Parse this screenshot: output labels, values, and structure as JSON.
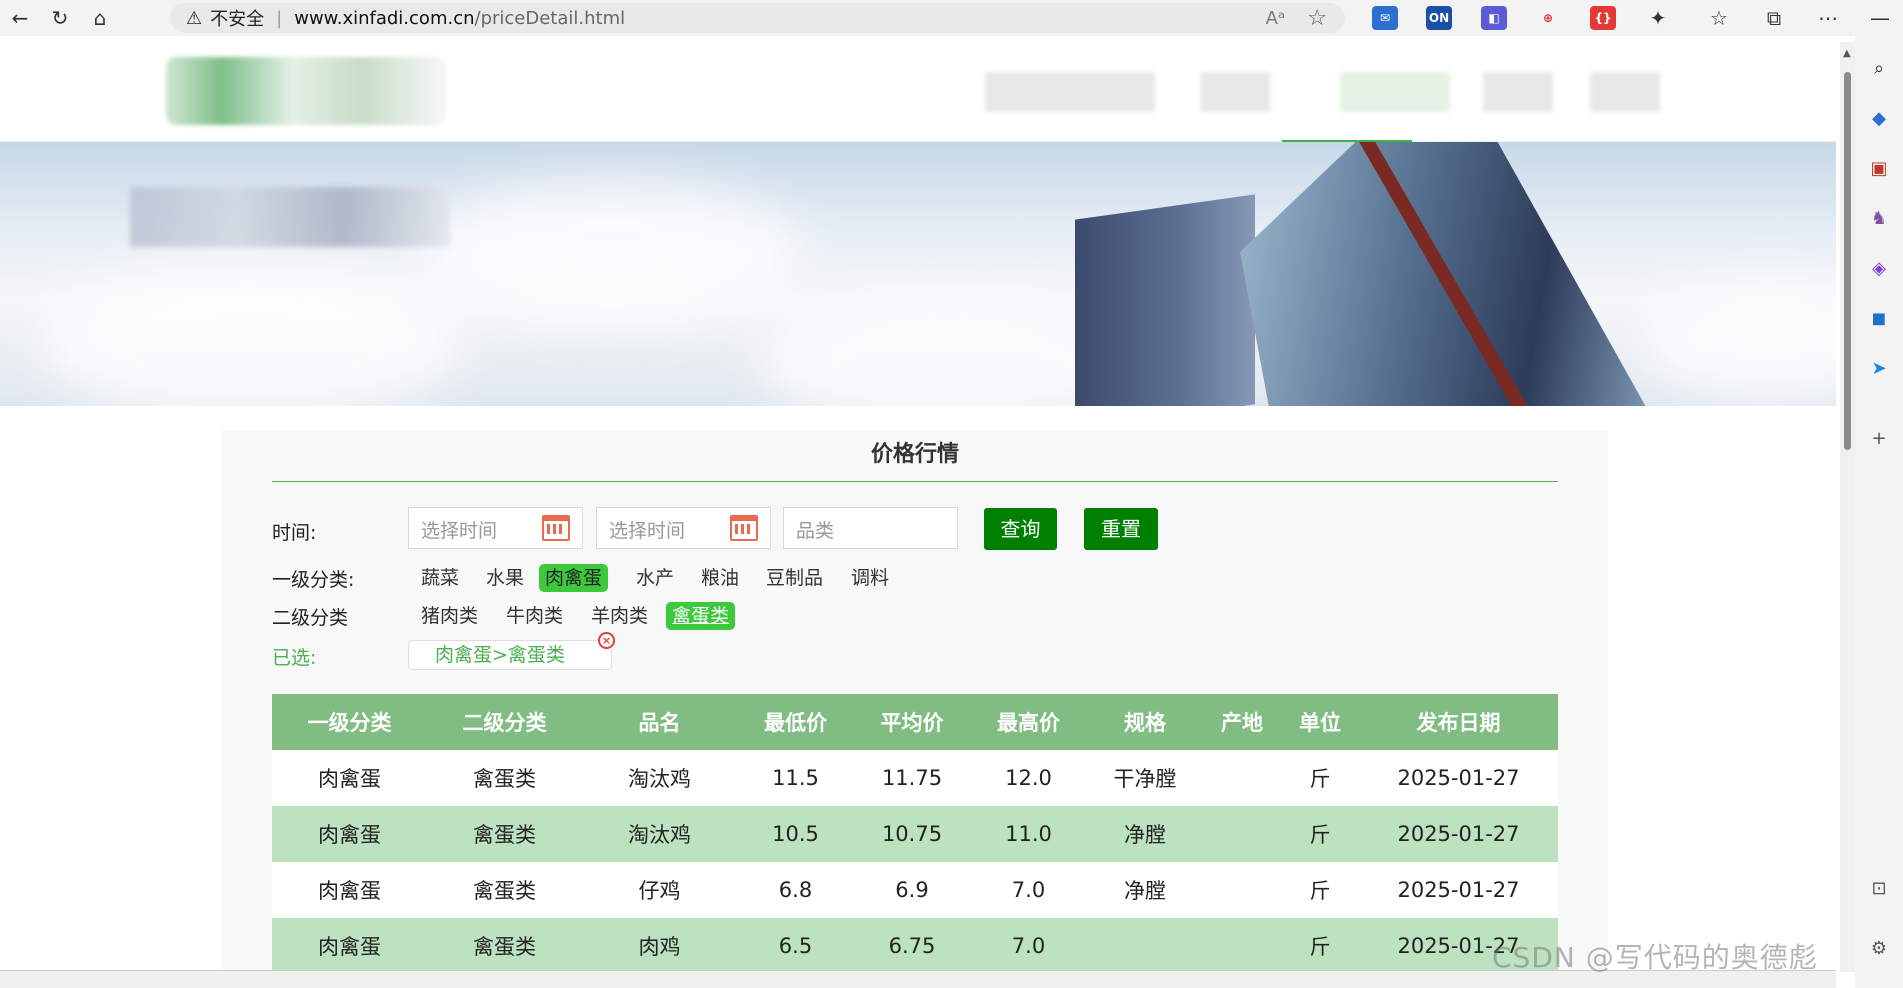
{
  "browser": {
    "security_label": "不安全",
    "url_host": "www.xinfadi.com.cn",
    "url_path": "/priceDetail.html",
    "ext_badge_on": "ON"
  },
  "page": {
    "title": "价格行情",
    "time_label": "时间:",
    "start_placeholder": "选择时间",
    "end_placeholder": "选择时间",
    "category_placeholder": "品类",
    "query_button": "查询",
    "reset_button": "重置",
    "level1_label": "一级分类:",
    "level2_label": "二级分类",
    "selected_label": "已选:",
    "selected_value": "肉禽蛋>禽蛋类",
    "level1_items": [
      "蔬菜",
      "水果",
      "肉禽蛋",
      "水产",
      "粮油",
      "豆制品",
      "调料"
    ],
    "level1_selected": "肉禽蛋",
    "level2_items": [
      "猪肉类",
      "牛肉类",
      "羊肉类",
      "禽蛋类"
    ],
    "level2_selected": "禽蛋类"
  },
  "table": {
    "headers": [
      "一级分类",
      "二级分类",
      "品名",
      "最低价",
      "平均价",
      "最高价",
      "规格",
      "产地",
      "单位",
      "发布日期"
    ],
    "rows": [
      [
        "肉禽蛋",
        "禽蛋类",
        "淘汰鸡",
        "11.5",
        "11.75",
        "12.0",
        "干净膛",
        "",
        "斤",
        "2025-01-27"
      ],
      [
        "肉禽蛋",
        "禽蛋类",
        "淘汰鸡",
        "10.5",
        "10.75",
        "11.0",
        "净膛",
        "",
        "斤",
        "2025-01-27"
      ],
      [
        "肉禽蛋",
        "禽蛋类",
        "仔鸡",
        "6.8",
        "6.9",
        "7.0",
        "净膛",
        "",
        "斤",
        "2025-01-27"
      ],
      [
        "肉禽蛋",
        "禽蛋类",
        "肉鸡",
        "6.5",
        "6.75",
        "7.0",
        "",
        "",
        "斤",
        "2025-01-27"
      ]
    ]
  },
  "watermark": "CSDN @写代码的奥德彪",
  "colors": {
    "accent_green": "#008000",
    "active_tag": "#3cc93c",
    "table_header": "#81bd83",
    "table_alt_row": "#bde2c0"
  }
}
